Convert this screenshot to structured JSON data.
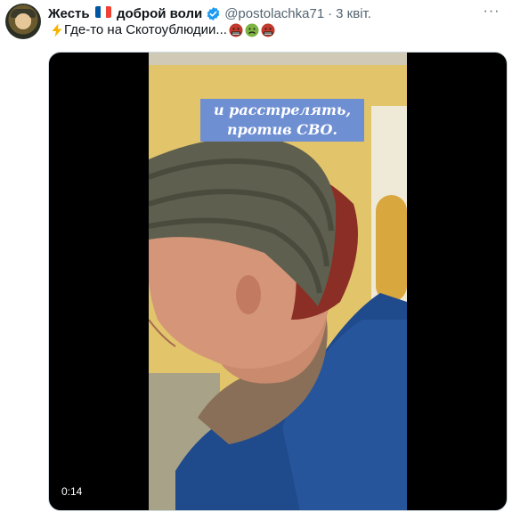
{
  "tweet": {
    "display_name_part1": "Жесть",
    "display_name_part2": "доброй воли",
    "handle": "@postolachka71",
    "separator": "·",
    "date": "3 квіт.",
    "more_label": "···",
    "text": "Где-то на Скотоублюдии...",
    "flag_colors": [
      "#0055a4",
      "#ffffff",
      "#ef4135"
    ],
    "verified_color": "#1d9bf0",
    "leading_icon": "lightning-icon",
    "trailing_icons": [
      "angry-face-icon",
      "nauseated-face-icon",
      "angry-face-icon"
    ]
  },
  "media": {
    "caption_line1": "и расстрелять,",
    "caption_line2": "против СВО.",
    "duration": "0:14",
    "caption_bg": "#6f8fd3"
  }
}
